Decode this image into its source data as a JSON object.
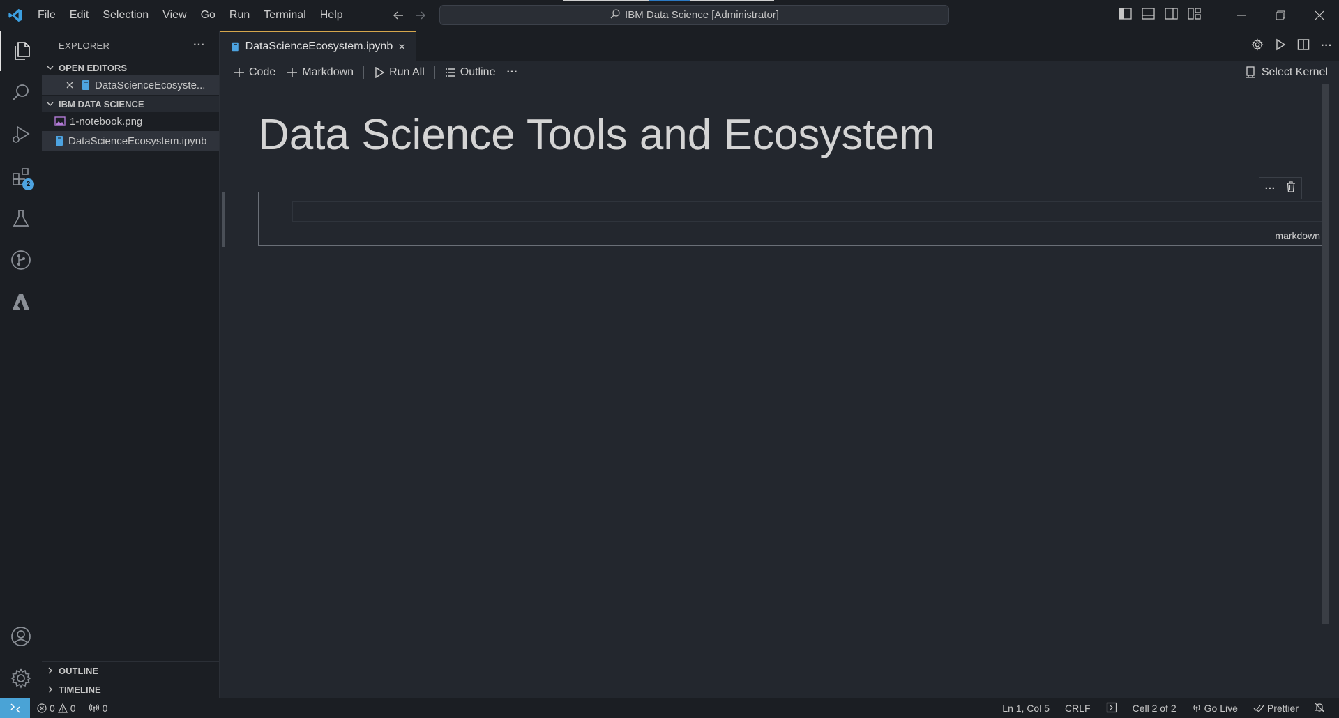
{
  "menu": [
    "File",
    "Edit",
    "Selection",
    "View",
    "Go",
    "Run",
    "Terminal",
    "Help"
  ],
  "command_center": "IBM Data Science [Administrator]",
  "activity": {
    "extensions_badge": "2"
  },
  "sidebar": {
    "title": "EXPLORER",
    "more": "···",
    "open_editors_title": "OPEN EDITORS",
    "open_editor_file": "DataScienceEcosyste...",
    "folder_title": "IBM DATA SCIENCE",
    "files": [
      "1-notebook.png",
      "DataScienceEcosystem.ipynb"
    ],
    "outline_title": "OUTLINE",
    "timeline_title": "TIMELINE"
  },
  "tab": {
    "label": "DataScienceEcosystem.ipynb"
  },
  "toolbar": {
    "code": "Code",
    "markdown": "Markdown",
    "run_all": "Run All",
    "outline": "Outline",
    "more": "···",
    "select_kernel": "Select Kernel"
  },
  "notebook": {
    "title": "Data Science Tools and Ecosystem",
    "cell_language": "markdown",
    "cell_tools_more": "···"
  },
  "status": {
    "errors": "0",
    "warnings": "0",
    "ports": "0",
    "position": "Ln 1, Col 5",
    "eol": "CRLF",
    "cell": "Cell 2 of 2",
    "go_live": "Go Live",
    "prettier": "Prettier"
  },
  "colors": {
    "accent_tab": "#d6a74d",
    "remote": "#4aa3d6",
    "badge": "#4da3e0",
    "vscode_logo": "#3c9fe0"
  }
}
